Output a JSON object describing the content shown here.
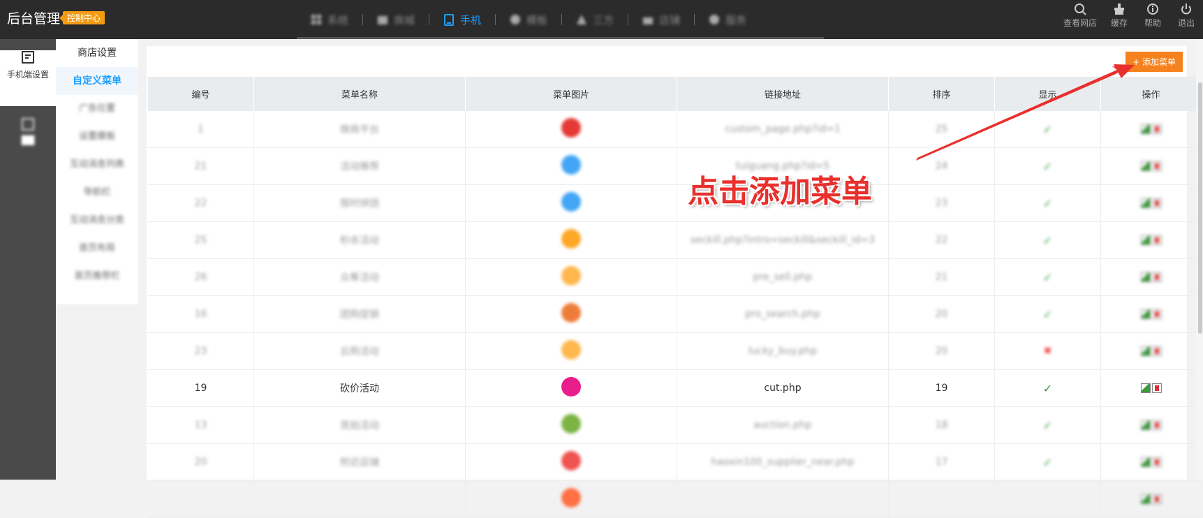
{
  "header": {
    "logo": "后台管理",
    "badge": "控制中心",
    "nav": [
      {
        "label": "系统",
        "icon": "grid-icon",
        "active": false
      },
      {
        "label": "商城",
        "icon": "shop-icon",
        "active": false
      },
      {
        "label": "手机",
        "icon": "phone-icon",
        "active": true
      },
      {
        "label": "模板",
        "icon": "template-icon",
        "active": false
      },
      {
        "label": "三方",
        "icon": "share-icon",
        "active": false
      },
      {
        "label": "店铺",
        "icon": "store-icon",
        "active": false
      },
      {
        "label": "服务",
        "icon": "service-icon",
        "active": false
      }
    ],
    "tools": [
      {
        "label": "查看网店",
        "icon": "search-icon"
      },
      {
        "label": "缓存",
        "icon": "clean-icon"
      },
      {
        "label": "帮助",
        "icon": "info-icon"
      },
      {
        "label": "退出",
        "icon": "power-icon"
      }
    ]
  },
  "leftnav": [
    {
      "label": "手机端设置",
      "icon": "settings-doc-icon",
      "active": true
    },
    {
      "label": "(blurred)",
      "icon": "edit-doc-icon",
      "active": false
    }
  ],
  "subnav": {
    "items": [
      {
        "label": "商店设置",
        "active": false,
        "blur": false
      },
      {
        "label": "自定义菜单",
        "active": true,
        "blur": false
      },
      {
        "label": "广告位置",
        "active": false,
        "blur": true
      },
      {
        "label": "设置模板",
        "active": false,
        "blur": true
      },
      {
        "label": "互动消息列表",
        "active": false,
        "blur": true
      },
      {
        "label": "导航栏",
        "active": false,
        "blur": true
      },
      {
        "label": "互动消息分类",
        "active": false,
        "blur": true
      },
      {
        "label": "首页布局",
        "active": false,
        "blur": true
      },
      {
        "label": "首页推荐栏",
        "active": false,
        "blur": true
      }
    ]
  },
  "toolbar": {
    "add_label": "+ 添加菜单"
  },
  "table": {
    "headers": [
      "编号",
      "菜单名称",
      "菜单图片",
      "链接地址",
      "排序",
      "显示",
      "操作"
    ],
    "rows": [
      {
        "id": "1",
        "name": "微商平台",
        "color": "#e53935",
        "link": "custom_page.php?id=1",
        "sort": "25",
        "show": true,
        "blur": true
      },
      {
        "id": "21",
        "name": "活动推荐",
        "color": "#42a5f5",
        "link": "tuiguang.php?id=5",
        "sort": "24",
        "show": true,
        "blur": true
      },
      {
        "id": "22",
        "name": "限时拼团",
        "color": "#42a5f5",
        "link": "",
        "sort": "23",
        "show": true,
        "blur": true
      },
      {
        "id": "25",
        "name": "秒杀活动",
        "color": "#ffa726",
        "link": "seckill.php?intro=seckill&seckill_id=3",
        "sort": "22",
        "show": true,
        "blur": true
      },
      {
        "id": "26",
        "name": "众筹活动",
        "color": "#ffb74d",
        "link": "pre_sell.php",
        "sort": "21",
        "show": true,
        "blur": true
      },
      {
        "id": "16",
        "name": "团购促销",
        "color": "#ef7d3a",
        "link": "pro_search.php",
        "sort": "20",
        "show": true,
        "blur": true
      },
      {
        "id": "23",
        "name": "云购活动",
        "color": "#ffb74d",
        "link": "lucky_buy.php",
        "sort": "20",
        "show": false,
        "blur": true
      },
      {
        "id": "19",
        "name": "砍价活动",
        "color": "#e91e8c",
        "link": "cut.php",
        "sort": "19",
        "show": true,
        "blur": false
      },
      {
        "id": "13",
        "name": "竞拍活动",
        "color": "#7cb342",
        "link": "auction.php",
        "sort": "18",
        "show": true,
        "blur": true
      },
      {
        "id": "20",
        "name": "附近店铺",
        "color": "#ef5350",
        "link": "haoxin100_supplier_near.php",
        "sort": "17",
        "show": true,
        "blur": true
      },
      {
        "id": "",
        "name": "",
        "color": "#ff7043",
        "link": "",
        "sort": "",
        "show": false,
        "blur": true
      }
    ]
  },
  "annotation": {
    "text": "点击添加菜单"
  },
  "colors": {
    "accent": "#1e9fff",
    "button": "#f5821f",
    "annotation": "#e8302c"
  }
}
